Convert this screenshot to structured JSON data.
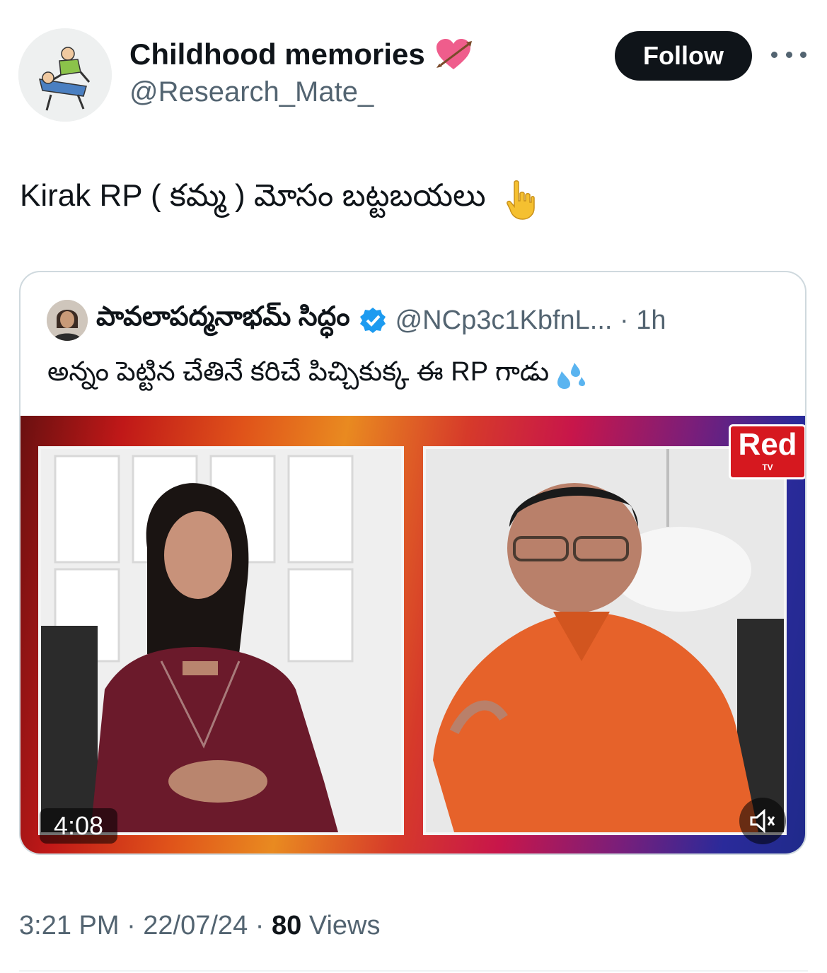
{
  "author": {
    "display_name": "Childhood memories",
    "handle": "@Research_Mate_"
  },
  "actions": {
    "follow_label": "Follow"
  },
  "tweet": {
    "text": "Kirak RP ( కమ్మ ) మోసం బట్టబయలు"
  },
  "quote": {
    "display_name": "పావలాపద్మనాభమ్ సిద్ధం",
    "handle_time": "@NCp3c1KbfnL... · 1h",
    "text": "అన్నం పెట్టిన చేతినే కరిచే పిచ్చికుక్క ఈ RP గాడు",
    "media": {
      "logo_text": "Red",
      "logo_sub": "TV",
      "duration": "4:08"
    }
  },
  "meta": {
    "time_date": "3:21 PM · 22/07/24 · ",
    "views_count": "80",
    "views_label": " Views"
  },
  "colors": {
    "text_primary": "#0f1419",
    "text_secondary": "#536471",
    "follow_bg": "#0f1419",
    "verified": "#1d9bf0",
    "border": "#cfd9de"
  },
  "icons": [
    "heart-with-arrow-icon",
    "more-icon",
    "pointing-down-icon",
    "verified-icon",
    "sweat-drops-icon",
    "volume-icon"
  ]
}
